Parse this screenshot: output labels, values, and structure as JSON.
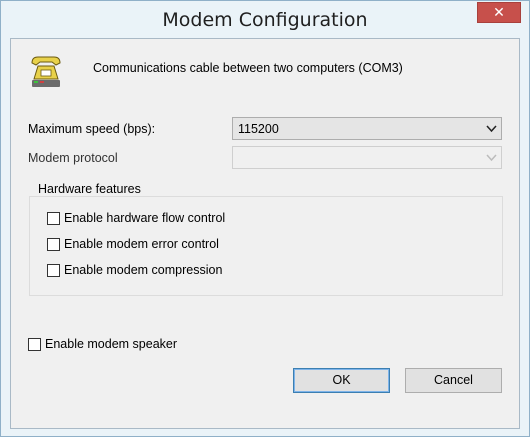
{
  "window": {
    "title": "Modem Configuration",
    "close_glyph": "✕"
  },
  "header": {
    "icon": "telephone-modem-icon",
    "description": "Communications cable between two computers (COM3)"
  },
  "speed": {
    "label": "Maximum speed (bps):",
    "value": "115200"
  },
  "protocol": {
    "label": "Modem protocol",
    "value": "",
    "enabled": false
  },
  "hardware": {
    "legend": "Hardware features",
    "options": [
      {
        "label": "Enable hardware flow control",
        "checked": false
      },
      {
        "label": "Enable modem error control",
        "checked": false
      },
      {
        "label": "Enable modem compression",
        "checked": false
      }
    ]
  },
  "speaker": {
    "label": "Enable modem speaker",
    "checked": false
  },
  "buttons": {
    "ok": "OK",
    "cancel": "Cancel"
  },
  "colors": {
    "close_button": "#c7504b",
    "window_frame": "#eaf3f8",
    "dialog_bg": "#f0f0f0",
    "default_button_border": "#3c7fb1"
  }
}
